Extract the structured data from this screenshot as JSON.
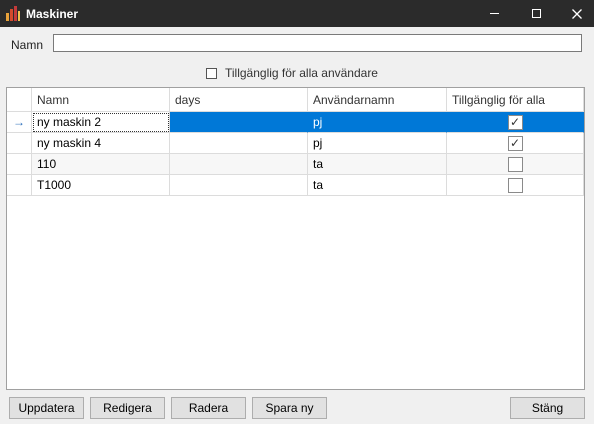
{
  "window": {
    "title": "Maskiner",
    "icon": "app-chart-icon",
    "controls": [
      "minimize-icon",
      "maximize-icon",
      "close-icon"
    ]
  },
  "filter": {
    "name_label": "Namn",
    "name_value": "",
    "available_all_label": "Tillgänglig för alla användare",
    "available_all_checked": false
  },
  "grid": {
    "columns": [
      "Namn",
      "days",
      "Användarnamn",
      "Tillgänglig för alla"
    ],
    "rows": [
      {
        "namn": "ny maskin 2",
        "days": "",
        "user": "pj",
        "available": true,
        "selected": true
      },
      {
        "namn": "ny maskin 4",
        "days": "",
        "user": "pj",
        "available": true,
        "selected": false
      },
      {
        "namn": "110",
        "days": "",
        "user": "ta",
        "available": false,
        "selected": false
      },
      {
        "namn": "T1000",
        "days": "",
        "user": "ta",
        "available": false,
        "selected": false
      }
    ],
    "current_row_icon": "arrow-right-icon",
    "selection_color": "#0078d7"
  },
  "buttons": {
    "update": "Uppdatera",
    "edit": "Redigera",
    "delete": "Radera",
    "save_new": "Spara ny",
    "close": "Stäng"
  }
}
